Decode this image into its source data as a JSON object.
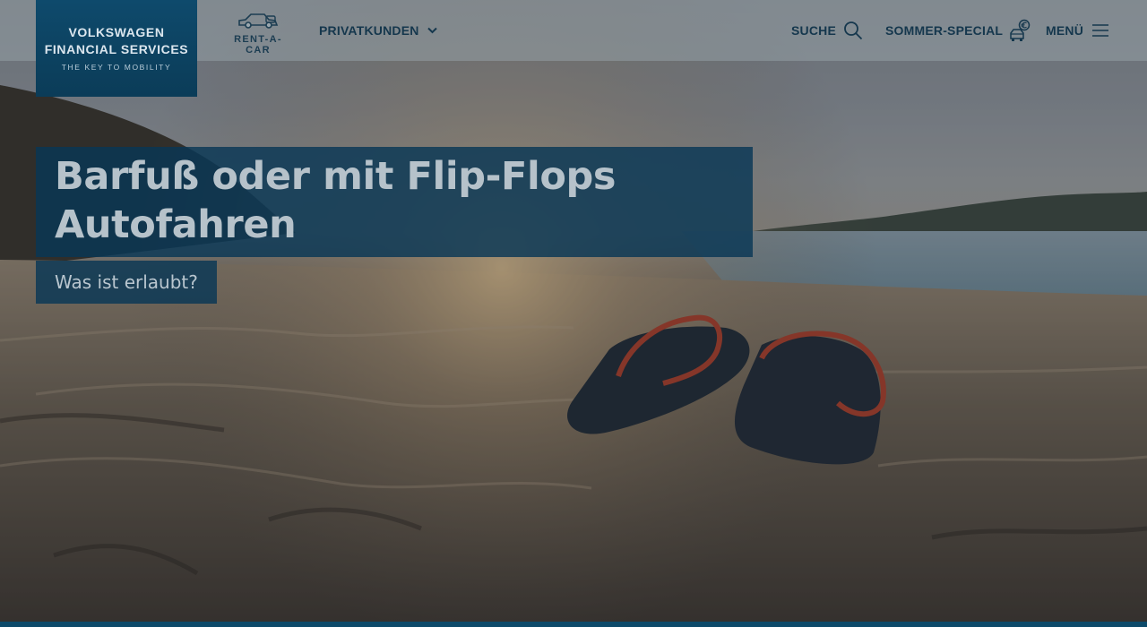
{
  "brand": {
    "logo_line1": "VOLKSWAGEN",
    "logo_line2": "FINANCIAL SERVICES",
    "logo_tagline": "THE KEY TO MOBILITY",
    "rentacar_label": "RENT-A-CAR",
    "color_primary": "#0b3c58"
  },
  "nav": {
    "privatkunden_label": "PRIVATKUNDEN",
    "suche_label": "SUCHE",
    "sommer_label": "SOMMER-SPECIAL",
    "menu_label": "MENÜ",
    "icons": {
      "privatkunden": "chevron-down-icon",
      "suche": "search-icon",
      "sommer": "car-euro-icon",
      "menu": "hamburger-icon",
      "rentacar": "car-key-icon"
    }
  },
  "hero": {
    "headline_line1": "Barfuß oder mit Flip-Flops",
    "headline_line2": "Autofahren",
    "subline": "Was ist erlaubt?",
    "image": "beach-flip-flops-photo"
  }
}
